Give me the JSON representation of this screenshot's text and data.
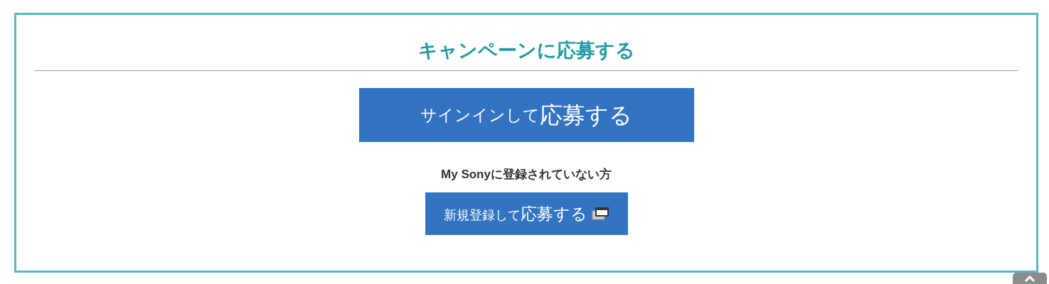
{
  "title": "キャンペーンに応募する",
  "signin_button": {
    "lead": "サインインして",
    "main": "応募する"
  },
  "register_note": "My Sonyに登録されていない方",
  "register_button": {
    "lead": "新規登録して",
    "main": "応募する"
  }
}
